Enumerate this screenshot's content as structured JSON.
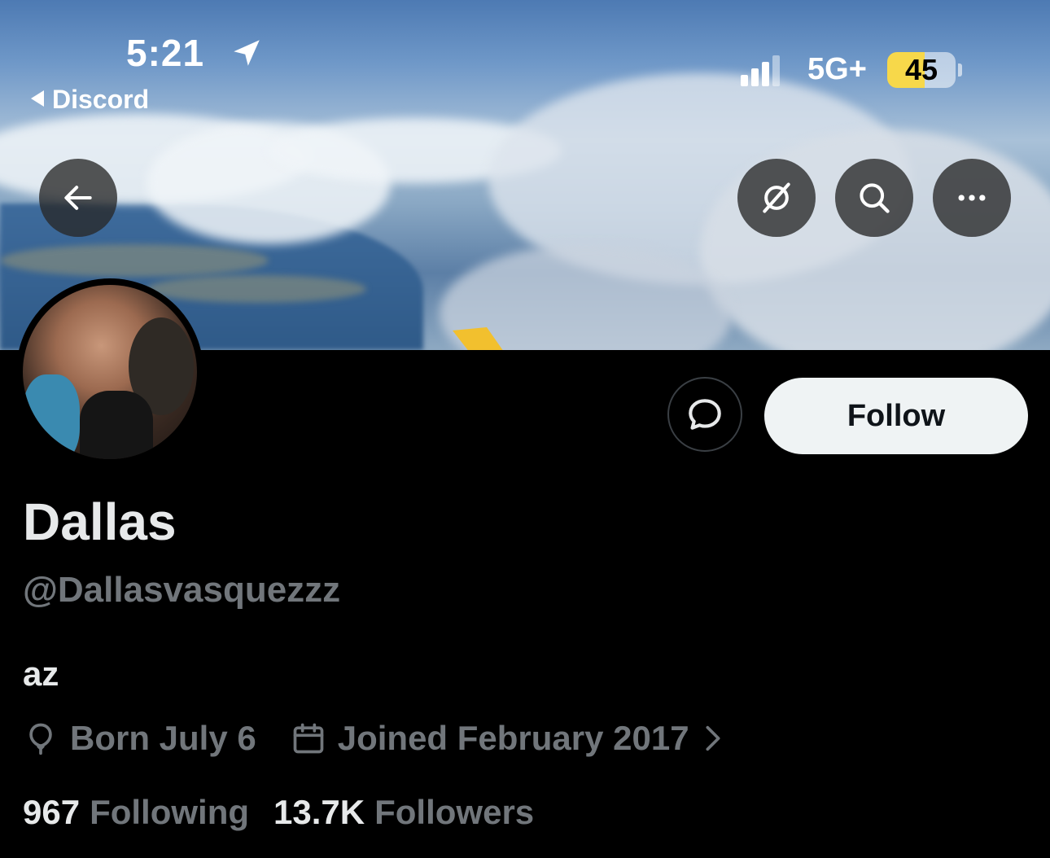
{
  "status_bar": {
    "time": "5:21",
    "back_app": "Discord",
    "network": "5G+",
    "battery": "45"
  },
  "header": {
    "back_icon": "arrow-left-icon",
    "grok_icon": "grok-icon",
    "search_icon": "search-icon",
    "more_icon": "more-horizontal-icon"
  },
  "profile": {
    "follow_label": "Follow",
    "name": "Dallas",
    "handle": "@Dallasvasquezzz",
    "bio": "az",
    "born": "Born July 6",
    "joined": "Joined February 2017",
    "following_count": "967",
    "following_label": "Following",
    "followers_count": "13.7K",
    "followers_label": "Followers"
  }
}
